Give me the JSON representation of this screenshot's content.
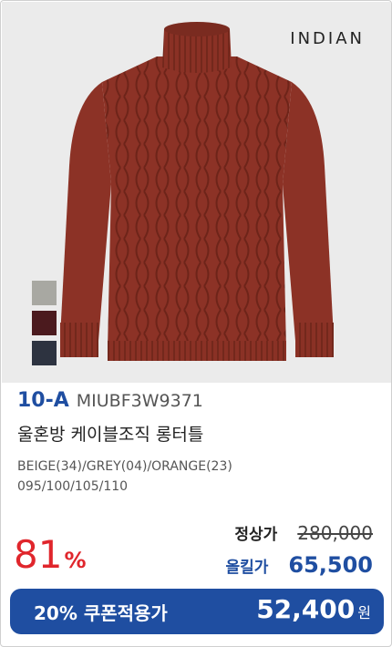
{
  "product": {
    "brand": "INDIAN",
    "model_code": "10-A",
    "style_code": "MIUBF3W9371",
    "name": "울혼방 케이블조직 롱터틀",
    "colors": "BEIGE(34)/GREY(04)/ORANGE(23)",
    "sizes": "095/100/105/110",
    "swatch_colors": [
      "#a8a8a2",
      "#4b1a1e",
      "#2d3340"
    ],
    "sweater_color": "#8c3226"
  },
  "pricing": {
    "discount_number": "81",
    "discount_symbol": "%",
    "regular_label": "정상가",
    "regular_price": "280,000",
    "sale_label": "올킬가",
    "sale_price": "65,500",
    "coupon_label": "20% 쿠폰적용가",
    "coupon_price": "52,400",
    "currency": "원"
  },
  "colors": {
    "accent_blue": "#1f4ea1",
    "discount_red": "#e0262c"
  }
}
